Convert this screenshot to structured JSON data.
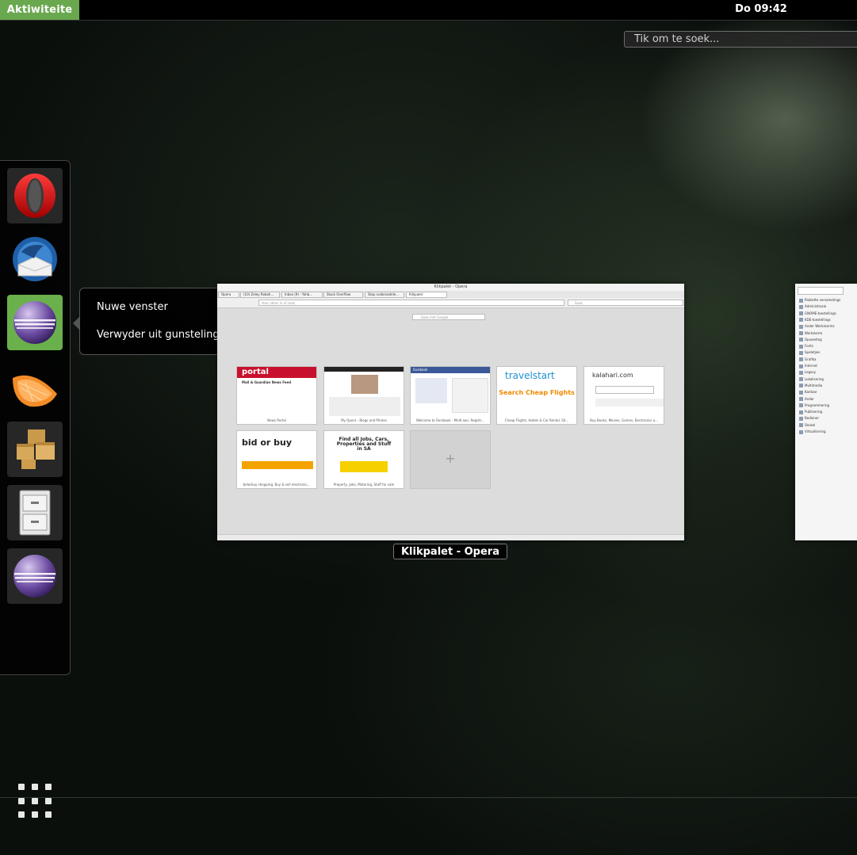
{
  "topbar": {
    "activities_label": "Aktiwiteite",
    "clock": "Do 09:42"
  },
  "search": {
    "placeholder": "Tik om te soek..."
  },
  "dash": {
    "items": [
      {
        "name": "Opera",
        "icon": "opera-icon"
      },
      {
        "name": "Thunderbird",
        "icon": "thunderbird-icon"
      },
      {
        "name": "Eclipse",
        "icon": "eclipse-icon",
        "active": true
      },
      {
        "name": "Clementine",
        "icon": "clementine-icon"
      },
      {
        "name": "Packages",
        "icon": "packages-icon"
      },
      {
        "name": "Files",
        "icon": "file-cabinet-icon"
      },
      {
        "name": "Eclipse",
        "icon": "eclipse-icon"
      }
    ],
    "show_apps_icon": "grid-icon"
  },
  "context_menu": {
    "items": [
      "Nuwe venster",
      "Verwyder uit gunstelinge"
    ]
  },
  "window": {
    "label": "Klikpalet - Opera",
    "titlebar": "Klikpalet - Opera",
    "tabs": [
      "Opera",
      "(10) Zeley Roboh...",
      "Inbox (9) - Yahb...",
      "Stack Overflow",
      "Stap rusbenadele...",
      "Klikpalet"
    ],
    "address_placeholder": "Voer adres in of soek",
    "search_placeholder": "Soek",
    "google_placeholder": "Soek met Google",
    "speed_dial": [
      {
        "caption": "News Portal",
        "headline": "portal",
        "color": "#c8102e"
      },
      {
        "caption": "My Opera - Blogs and Photos",
        "headline": "",
        "color": "#333333"
      },
      {
        "caption": "Welcome to Facebook - Meld aan, Registr...",
        "headline": "facebook",
        "color": "#3b5998"
      },
      {
        "caption": "Cheap Flights, Hotels & Car Rental, Sti...",
        "headline": "travelstart",
        "color": "#1d8fd0"
      },
      {
        "caption": "Buy Books, Movies, Games, Electronics a...",
        "headline": "kalahari.com",
        "color": "#333333"
      },
      {
        "caption": "bidorbuy shopping, Buy & sell electronic...",
        "headline": "bid or buy",
        "color": "#e8a000"
      },
      {
        "caption": "Property, Jobs, Motoring, Stuff for sale",
        "headline": "Find all Jobs, Cars, Properties and Stuff in SA",
        "color": "#f7d000"
      }
    ],
    "search_flights": "Search Cheap Flights",
    "portal_news": "Mail & Guardian News Feed"
  },
  "window2": {
    "items": [
      "Pakkette versamelings",
      "Administrasie",
      "GNOME-toestellings",
      "KDE-toestellings",
      "Ander Werkskerms",
      "Werkskerm",
      "Opvoeding",
      "Fonts",
      "Speletjies",
      "Grafika",
      "Internet",
      "Legacy",
      "Lokalisering",
      "Multimedia",
      "Kantoor",
      "Ander",
      "Programmering",
      "Publisering",
      "Bediener",
      "Stelsel",
      "Virtualisering"
    ]
  }
}
